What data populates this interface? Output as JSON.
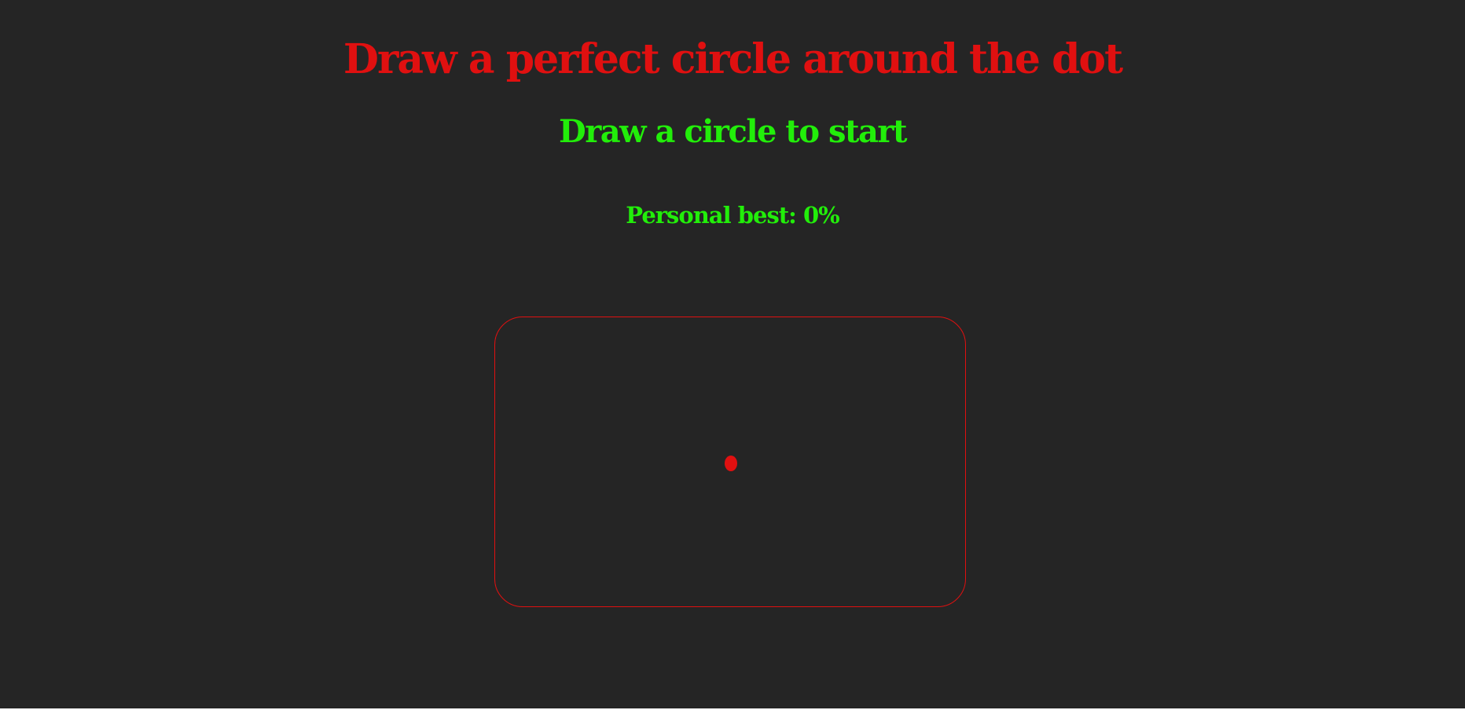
{
  "header": {
    "title": "Draw a perfect circle around the dot",
    "status": "Draw a circle to start",
    "personal_best": "Personal best: 0%"
  },
  "colors": {
    "background": "#252525",
    "title": "#e01010",
    "status": "#22ee0a",
    "canvas_border": "#e01010",
    "dot": "#e01010"
  },
  "icons": {
    "center_dot": "center-dot"
  }
}
